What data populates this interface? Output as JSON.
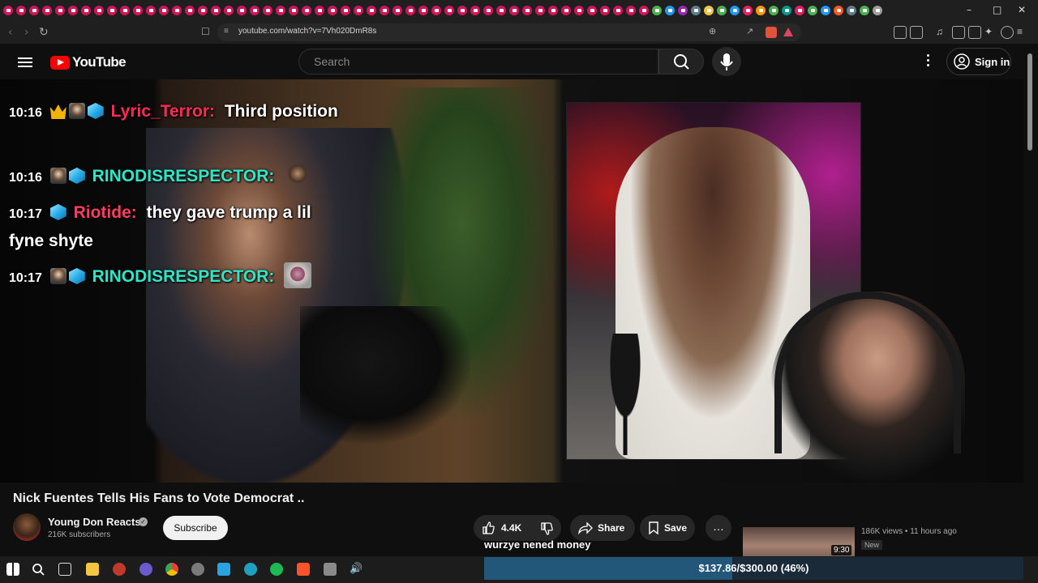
{
  "browser": {
    "url": "youtube.com/watch?v=7Vh020DmR8s"
  },
  "header": {
    "logo_text": "YouTube",
    "search_placeholder": "Search",
    "signin_label": "Sign in"
  },
  "chat": [
    {
      "time": "10:16",
      "user": "Lyric_Terror:",
      "user_color": "#ff2d55",
      "message": "Third position"
    },
    {
      "time": "10:16",
      "user": "RINODISRESPECTOR:",
      "user_color": "#2ee6c8",
      "message": ""
    },
    {
      "time": "10:17",
      "user": "Riotide:",
      "user_color": "#ff3d60",
      "message": "they gave trump a lil fyne shyte"
    },
    {
      "time": "10:17",
      "user": "RINODISRESPECTOR:",
      "user_color": "#2ee6c8",
      "message": ""
    }
  ],
  "video": {
    "title": "Nick Fuentes Tells His Fans to Vote Democrat ..",
    "channel": "Young Don Reacts",
    "subscribers": "216K subscribers",
    "subscribe_label": "Subscribe",
    "likes": "4.4K",
    "share_label": "Share",
    "save_label": "Save"
  },
  "recommended": {
    "duration": "9:30",
    "meta": "186K views • 11 hours ago",
    "badge": "New"
  },
  "stream_overlay": {
    "ticker": "wurzye nened money",
    "donation_text": "$137.86/$300.00 (46%)",
    "donation_progress": 0.46
  },
  "colors": {
    "youtube_red": "#ff0000",
    "background": "#0f0f0f"
  }
}
